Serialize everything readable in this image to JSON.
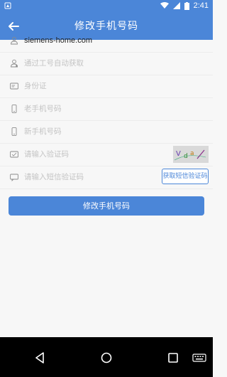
{
  "status_bar": {
    "time": "2:41"
  },
  "app_bar": {
    "title": "修改手机号码"
  },
  "form": {
    "rows": [
      {
        "icon": "user-icon",
        "value": "siemens-home.com"
      },
      {
        "icon": "user-id-icon",
        "placeholder": "通过工号自动获取"
      },
      {
        "icon": "id-card-icon",
        "placeholder": "身份证"
      },
      {
        "icon": "phone-icon",
        "placeholder": "老手机号码"
      },
      {
        "icon": "phone-icon",
        "placeholder": "新手机号码"
      },
      {
        "icon": "verify-icon",
        "placeholder": "请输入验证码"
      },
      {
        "icon": "sms-icon",
        "placeholder": "请输入短信验证码"
      }
    ],
    "sms_button_label": "获取短信验证码"
  },
  "submit": {
    "label": "修改手机号码"
  },
  "colors": {
    "primary": "#4b86d8",
    "nav_bg": "#000000",
    "placeholder": "#c4c4c4"
  }
}
